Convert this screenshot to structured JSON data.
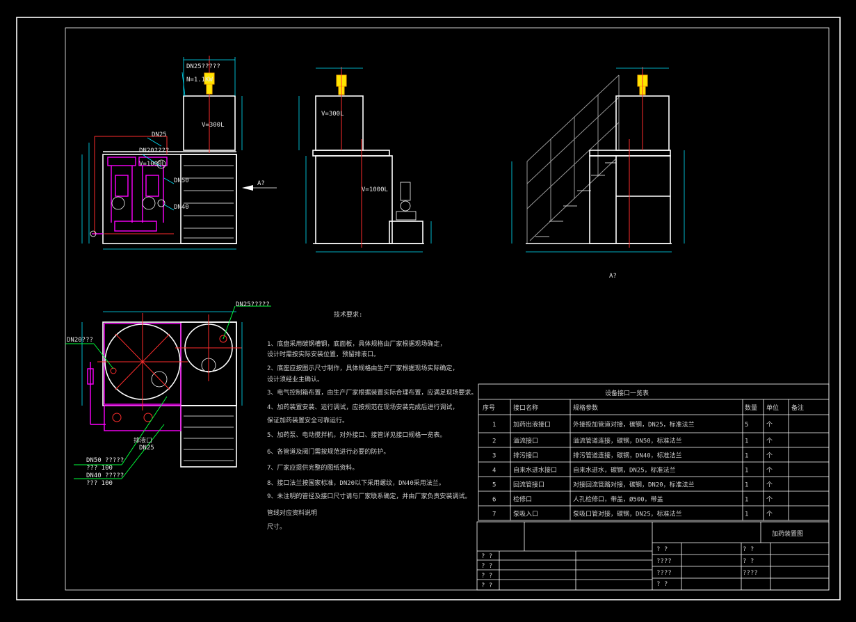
{
  "drawing": {
    "front_view": {
      "label_dn25_top": "DN25?????",
      "label_power": "N=1.1KW",
      "label_tank_small": "V=300L",
      "label_dn25_side": "DN25",
      "label_dn20": "DN20????",
      "label_tank_big": "V=1000L",
      "label_dn50": "DN50",
      "label_dn40": "DN40",
      "label_view_arrow": "A?"
    },
    "side_view": {
      "label_tank_small": "V=300L",
      "label_tank_big": "V=1000L"
    },
    "view_a": {
      "caption": "A?"
    },
    "plan_view": {
      "label_dn25_top": "DN25?????",
      "label_dn20": "DN20???",
      "label_drain": "排液口",
      "label_dn25_bottom": "DN25",
      "label_dn50_a": "DN50 ?????",
      "label_dn50_b": "???  100",
      "label_dn40_a": "DN40 ?????",
      "label_dn40_b": "???  100"
    }
  },
  "notes": {
    "title": "技术要求:",
    "lines": [
      "1、底盘采用碳钢槽钢，底面板，具体规格由厂家根据现场确定，",
      "   设计时需按实际安装位置，预留排液口。",
      "2、底座应按图示尺寸制作，具体规格由生产厂家根据现场实际确定，",
      "   设计须经业主确认。",
      "3、电气控制箱布置，由生产厂家根据装置实际合理布置，应满足现场要求。",
      "4、加药装置安装、运行调试，应按规范在现场安装完成后进行调试，",
      "   保证加药装置安全可靠运行。",
      "5、加药泵、电动搅拌机，对外接口、接管详见接口规格一览表。",
      "6、各管道及阀门需按规范进行必要的防护。",
      "7、厂家应提供完整的图纸资料。",
      "8、接口法兰按国家标准，DN20以下采用螺纹，DN40采用法兰。",
      "9、未注明的管径及接口尺寸请与厂家联系确定，并由厂家负责安装调试。",
      "   管线对应资料说明",
      "   尺寸。"
    ]
  },
  "interface_table": {
    "title": "设备接口一览表",
    "headers": [
      "序号",
      "接口名称",
      "规格参数",
      "数量",
      "单位",
      "备注"
    ],
    "rows": [
      [
        "1",
        "加药出液接口",
        "外接投加管道对接，碳钢，DN25，标准法兰",
        "5",
        "个",
        ""
      ],
      [
        "2",
        "溢流接口",
        "溢流管道连接，碳钢，DN50，标准法兰",
        "1",
        "个",
        ""
      ],
      [
        "3",
        "排污接口",
        "排污管道连接，碳钢，DN40，标准法兰",
        "1",
        "个",
        ""
      ],
      [
        "4",
        "自来水进水接口",
        "自来水进水，碳钢，DN25，标准法兰",
        "1",
        "个",
        ""
      ],
      [
        "5",
        "回流管接口",
        "对接回流管路对接，碳钢，DN20，标准法兰",
        "1",
        "个",
        ""
      ],
      [
        "6",
        "检修口",
        "人孔检修口，带盖，Ø500，带盖",
        "1",
        "个",
        ""
      ],
      [
        "7",
        "泵吸入口",
        "泵吸口管对接，碳钢，DN25，标准法兰",
        "1",
        "个",
        ""
      ]
    ]
  },
  "title_block": {
    "drawing_name": "加药装置图",
    "left_rows": [
      "? ?",
      "? ?",
      "? ?",
      "? ?"
    ],
    "mid_labels": [
      "? ?",
      "????",
      "????",
      "? ?"
    ],
    "right_labels": [
      "? ?",
      "? ?",
      "????"
    ]
  }
}
